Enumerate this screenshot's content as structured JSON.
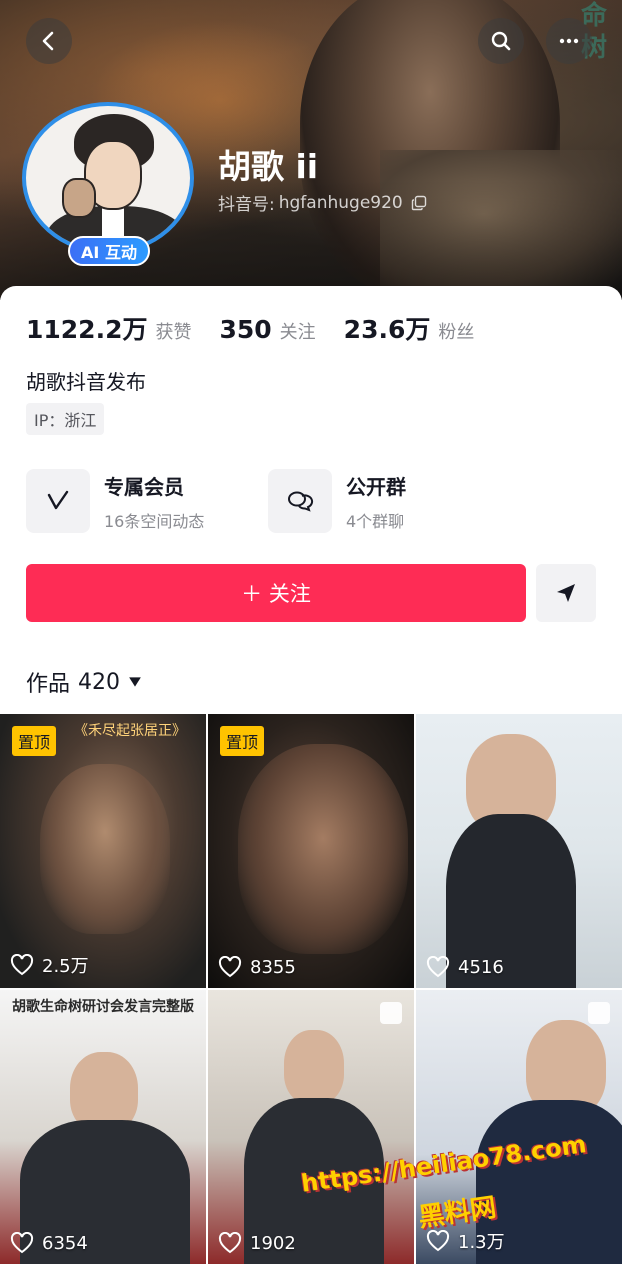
{
  "header": {
    "poster_title": "命树",
    "name": "胡歌 ii",
    "handle_label": "抖音号:",
    "handle_value": "hgfanhuge920",
    "ai_badge": "AI 互动"
  },
  "stats": [
    {
      "value": "1122.2万",
      "label": "获赞"
    },
    {
      "value": "350",
      "label": "关注"
    },
    {
      "value": "23.6万",
      "label": "粉丝"
    }
  ],
  "bio": "胡歌抖音发布",
  "ip": "IP：浙江",
  "features": [
    {
      "title": "专属会员",
      "subtitle": "16条空间动态",
      "icon": "v-member-icon"
    },
    {
      "title": "公开群",
      "subtitle": "4个群聊",
      "icon": "chat-bubbles-icon"
    }
  ],
  "actions": {
    "follow_label": "＋ 关注"
  },
  "works": {
    "label": "作品",
    "count": "420"
  },
  "videos": [
    {
      "pinned": "置顶",
      "likes": "2.5万",
      "caption": "《禾尽起张居正》"
    },
    {
      "pinned": "置顶",
      "likes": "8355",
      "caption": ""
    },
    {
      "pinned": "",
      "likes": "4516",
      "caption": ""
    },
    {
      "pinned": "",
      "likes": "6354",
      "caption": "胡歌生命树研讨会发言完整版"
    },
    {
      "pinned": "",
      "likes": "1902",
      "caption": ""
    },
    {
      "pinned": "",
      "likes": "1.3万",
      "caption": ""
    }
  ],
  "watermark": {
    "line1": "https://heiliao78.com",
    "line2": "黑料网"
  },
  "colors": {
    "accent": "#fe2c55",
    "pin": "#ffc300",
    "avatar_ring": "#2f8fe8"
  }
}
